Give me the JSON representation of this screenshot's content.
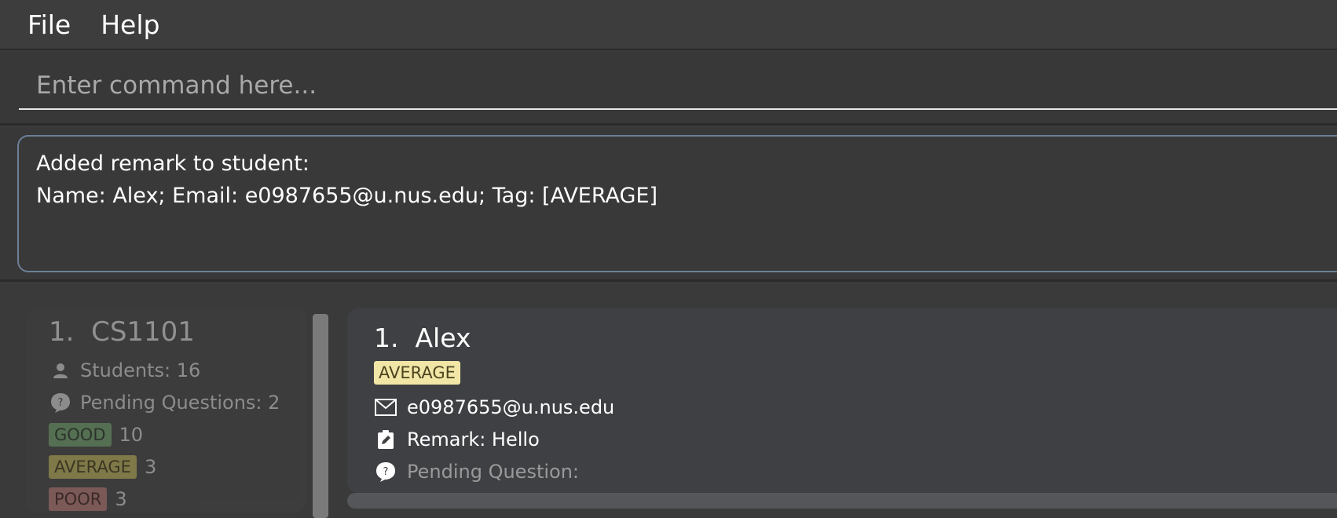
{
  "menu": {
    "file": "File",
    "help": "Help"
  },
  "command": {
    "placeholder": "Enter command here..."
  },
  "result": {
    "line1": "Added remark to student:",
    "line2": "Name: Alex; Email: e0987655@u.nus.edu; Tag: [AVERAGE]"
  },
  "class_card": {
    "index": "1.",
    "name": "CS1101",
    "students": "Students: 16",
    "pending": "Pending Questions: 2",
    "tags": [
      {
        "label": "GOOD",
        "count": "10"
      },
      {
        "label": "AVERAGE",
        "count": "3"
      },
      {
        "label": "POOR",
        "count": "3"
      }
    ]
  },
  "student_card": {
    "index": "1.",
    "name": "Alex",
    "tag": "AVERAGE",
    "email": "e0987655@u.nus.edu",
    "remark": "Remark: Hello",
    "pending": "Pending Question:"
  },
  "icons": [
    "person-icon",
    "question-icon",
    "mail-icon",
    "clipboard-edit-icon"
  ]
}
